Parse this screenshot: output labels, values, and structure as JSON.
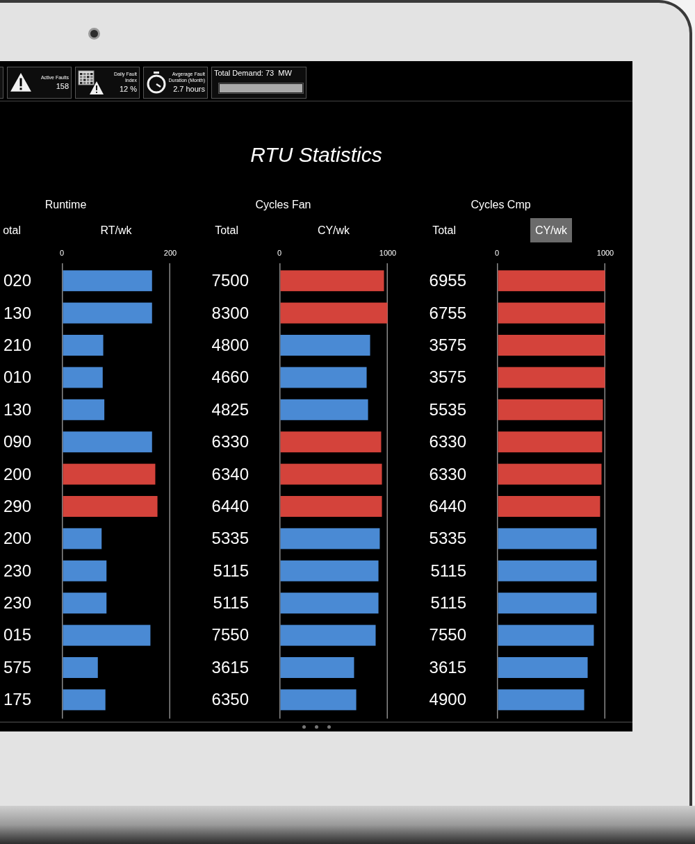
{
  "top_bar": {
    "tiles": [
      {
        "kind": "fault",
        "label": "Active Faults",
        "value": "158"
      },
      {
        "kind": "index",
        "label": "Daily Fault Index",
        "value": "12 %"
      },
      {
        "kind": "duration",
        "label": "Avgerage Fault Duration (Month)",
        "value": "2.7 hours"
      }
    ],
    "demand": {
      "label": "Total Demand: 73  MW",
      "level": 1
    }
  },
  "title": "RTU Statistics",
  "groups": [
    {
      "title": "Runtime",
      "columns": [
        {
          "label": "otal",
          "selected": false
        },
        {
          "label": "RT/wk",
          "selected": false
        }
      ],
      "totals": [
        "020",
        "130",
        "210",
        "010",
        "130",
        "090",
        "200",
        "290",
        "200",
        "230",
        "230",
        "015",
        "575",
        "175"
      ],
      "chart_data": {
        "type": "bar",
        "orientation": "horizontal",
        "xlim": [
          0,
          200
        ],
        "xticks": [
          0,
          200
        ],
        "values": [
          167,
          167,
          77,
          76,
          79,
          167,
          173,
          177,
          74,
          83,
          83,
          164,
          67,
          81
        ],
        "colors": [
          "#4a8ad4",
          "#4a8ad4",
          "#4a8ad4",
          "#4a8ad4",
          "#4a8ad4",
          "#4a8ad4",
          "#d4433b",
          "#d4433b",
          "#4a8ad4",
          "#4a8ad4",
          "#4a8ad4",
          "#4a8ad4",
          "#4a8ad4",
          "#4a8ad4"
        ]
      }
    },
    {
      "title": "Cycles Fan",
      "columns": [
        {
          "label": "Total",
          "selected": false
        },
        {
          "label": "CY/wk",
          "selected": false
        }
      ],
      "totals": [
        "7500",
        "8300",
        "4800",
        "4660",
        "4825",
        "6330",
        "6340",
        "6440",
        "5335",
        "5115",
        "5115",
        "7550",
        "3615",
        "6350"
      ],
      "chart_data": {
        "type": "bar",
        "orientation": "horizontal",
        "xlim": [
          0,
          1000
        ],
        "xticks": [
          0,
          1000
        ],
        "values": [
          968,
          1000,
          840,
          808,
          821,
          942,
          949,
          949,
          929,
          917,
          917,
          891,
          692,
          712
        ],
        "colors": [
          "#d4433b",
          "#d4433b",
          "#4a8ad4",
          "#4a8ad4",
          "#4a8ad4",
          "#d4433b",
          "#d4433b",
          "#d4433b",
          "#4a8ad4",
          "#4a8ad4",
          "#4a8ad4",
          "#4a8ad4",
          "#4a8ad4",
          "#4a8ad4"
        ]
      }
    },
    {
      "title": "Cycles Cmp",
      "columns": [
        {
          "label": "Total",
          "selected": false
        },
        {
          "label": "CY/wk",
          "selected": true
        }
      ],
      "totals": [
        "6955",
        "6755",
        "3575",
        "3575",
        "5535",
        "6330",
        "6330",
        "6440",
        "5335",
        "5115",
        "5115",
        "7550",
        "3615",
        "4900"
      ],
      "chart_data": {
        "type": "bar",
        "orientation": "horizontal",
        "xlim": [
          0,
          1000
        ],
        "xticks": [
          0,
          1000
        ],
        "values": [
          1000,
          1000,
          1000,
          1000,
          981,
          974,
          968,
          955,
          923,
          923,
          923,
          897,
          840,
          808
        ],
        "colors": [
          "#d4433b",
          "#d4433b",
          "#d4433b",
          "#d4433b",
          "#d4433b",
          "#d4433b",
          "#d4433b",
          "#d4433b",
          "#4a8ad4",
          "#4a8ad4",
          "#4a8ad4",
          "#4a8ad4",
          "#4a8ad4",
          "#4a8ad4"
        ]
      }
    }
  ]
}
